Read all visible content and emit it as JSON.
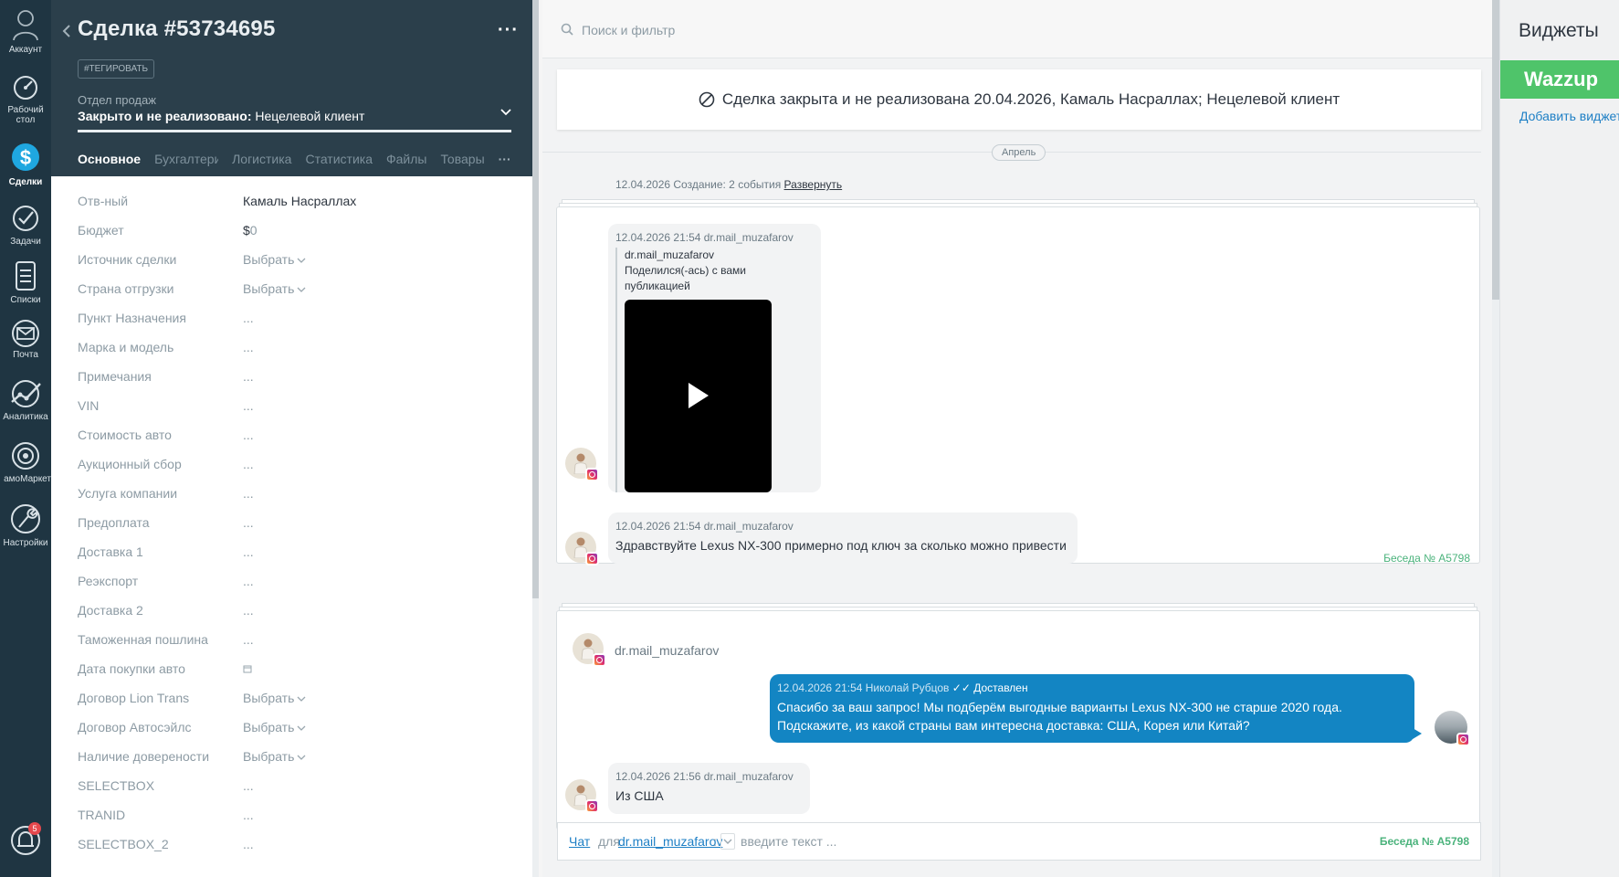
{
  "nav": {
    "items": [
      {
        "label": "Аккаунт",
        "icon": "account-icon"
      },
      {
        "label": "Рабочий стол",
        "icon": "dashboard-icon"
      },
      {
        "label": "Сделки",
        "icon": "deals-icon"
      },
      {
        "label": "Задачи",
        "icon": "tasks-icon"
      },
      {
        "label": "Списки",
        "icon": "lists-icon"
      },
      {
        "label": "Почта",
        "icon": "mail-icon"
      },
      {
        "label": "Аналитика",
        "icon": "analytics-icon"
      },
      {
        "label": "amoМаркет",
        "icon": "market-icon"
      },
      {
        "label": "Настройки",
        "icon": "settings-icon"
      }
    ],
    "notifications_count": "5"
  },
  "deal": {
    "title": "Сделка #53734695",
    "tag_button": "#ТЕГИРОВАТЬ",
    "pipeline_label": "Отдел продаж",
    "status_bold": "Закрыто и не реализовано:",
    "status_reason": "Нецелевой клиент",
    "tabs": [
      "Основное",
      "Бухгалтерия",
      "Логистика",
      "Статистика",
      "Файлы",
      "Товары"
    ],
    "fields": [
      {
        "label": "Отв-ный",
        "value": "Камаль Насраллах"
      },
      {
        "label": "Бюджет",
        "value": "$",
        "value_extra": "0"
      },
      {
        "label": "Источник сделки",
        "value": "Выбрать",
        "select": true
      },
      {
        "label": "Страна отгрузки",
        "value": "Выбрать",
        "select": true
      },
      {
        "label": "Пункт Назначения",
        "value": "..."
      },
      {
        "label": "Марка и модель",
        "value": "..."
      },
      {
        "label": "Примечания",
        "value": "..."
      },
      {
        "label": "VIN",
        "value": "..."
      },
      {
        "label": "Стоимость авто",
        "value": "..."
      },
      {
        "label": "Аукционный сбор",
        "value": "..."
      },
      {
        "label": "Услуга компании",
        "value": "..."
      },
      {
        "label": "Предоплата",
        "value": "..."
      },
      {
        "label": "Доставка 1",
        "value": "..."
      },
      {
        "label": "Реэкспорт",
        "value": "..."
      },
      {
        "label": "Доставка 2",
        "value": "..."
      },
      {
        "label": "Таможенная пошлина",
        "value": "..."
      },
      {
        "label": "Дата покупки авто",
        "value": "",
        "date": true
      },
      {
        "label": "Договор Lion Trans",
        "value": "Выбрать",
        "select": true
      },
      {
        "label": "Договор Автосэйлс",
        "value": "Выбрать",
        "select": true
      },
      {
        "label": "Наличие доверености",
        "value": "Выбрать",
        "select": true
      },
      {
        "label": "SELECTBOX",
        "value": "..."
      },
      {
        "label": "TRANID",
        "value": "..."
      },
      {
        "label": "SELECTBOX_2",
        "value": "..."
      }
    ]
  },
  "feed": {
    "search_placeholder": "Поиск и фильтр",
    "closed_banner": "Сделка закрыта и не реализована 20.04.2026, Камаль Насраллах; Нецелевой клиент",
    "month": "Апрель",
    "created": {
      "text": "12.04.2026 Создание: 2 события",
      "expand": "Развернуть"
    },
    "thread1": {
      "msg1": {
        "meta": "12.04.2026 21:54 dr.mail_muzafarov",
        "quote_user": "dr.mail_muzafarov",
        "quote_text": "Поделился(-ась) с вами публикацией"
      },
      "msg2": {
        "meta": "12.04.2026 21:54 dr.mail_muzafarov",
        "text": "Здравствуйте Lexus NX-300 примерно под ключ за сколько можно привести"
      },
      "talk": "Беседа № A5798"
    },
    "thread2": {
      "contact": "dr.mail_muzafarov",
      "out": {
        "meta": "12.04.2026 21:54 Николай Рубцов",
        "status": "Доставлен",
        "line1": "Спасибо за ваш запрос! Мы подберём выгодные варианты Lexus NX-300 не старше 2020 года.",
        "line2": "Подскажите, из какой страны вам интересна доставка: США, Корея или Китай?"
      },
      "reply": {
        "meta": "12.04.2026 21:56 dr.mail_muzafarov",
        "text": "Из США"
      }
    },
    "compose": {
      "chat": "Чат",
      "for": "для",
      "user": "dr.mail_muzafarov",
      "colon": ":",
      "placeholder": "введите текст ...",
      "talk": "Беседа № A5798"
    }
  },
  "widgets": {
    "title": "Виджеты",
    "wazzup": "Wazzup",
    "add": "Добавить виджет"
  },
  "colors": {
    "nav_bg": "#1f3542",
    "card_header_bg": "#2b3f4b",
    "outgoing_bubble": "#1385c3",
    "wazzup_green": "#4fc46a",
    "link_blue": "#1d7fc5",
    "talk_green": "#4bb37c"
  }
}
